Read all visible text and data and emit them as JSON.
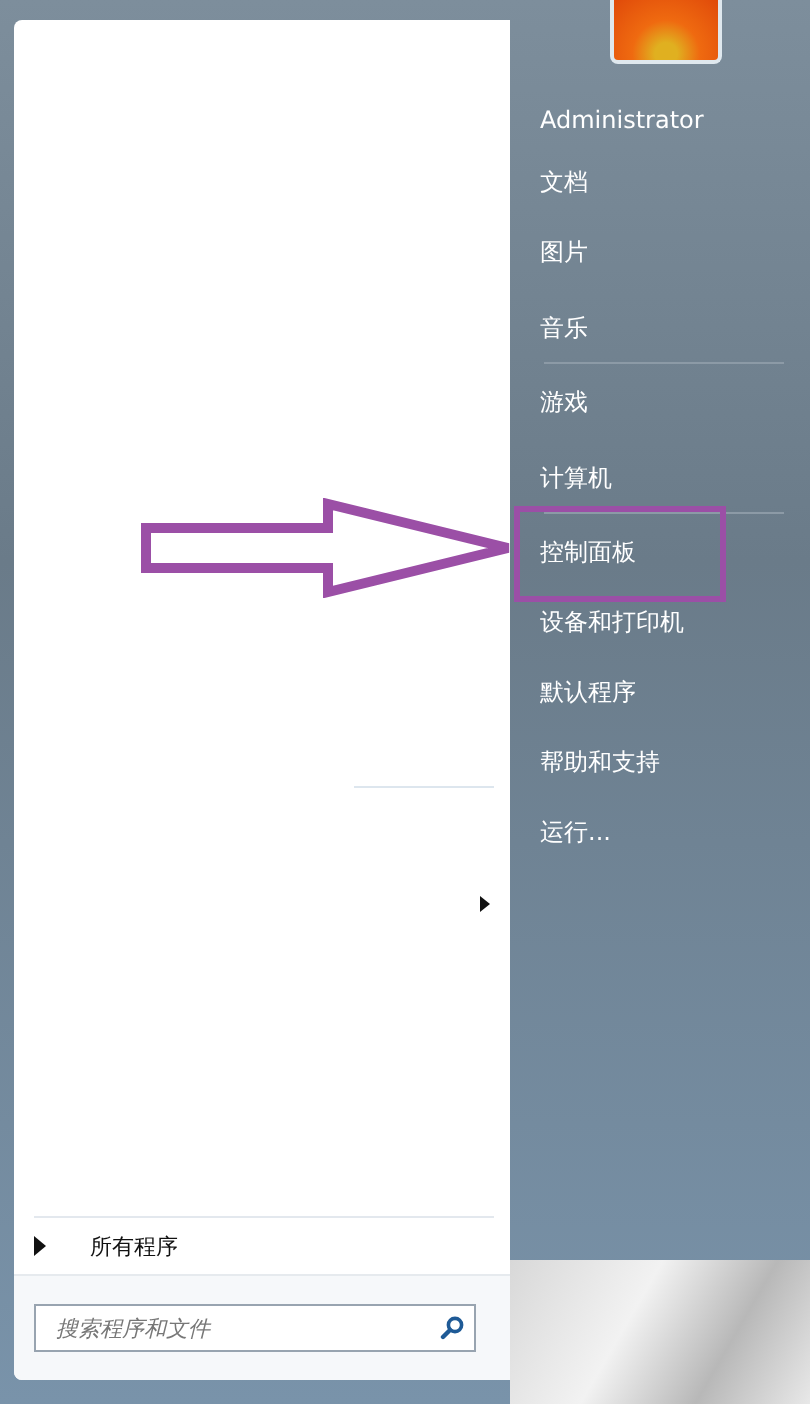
{
  "user": {
    "name": "Administrator"
  },
  "right_items": [
    {
      "label": "文档",
      "separator_after": false,
      "annotated": false
    },
    {
      "label": "图片",
      "separator_after": false,
      "annotated": false
    },
    {
      "label": "音乐",
      "separator_after": true,
      "annotated": false
    },
    {
      "label": "游戏",
      "separator_after": false,
      "annotated": false
    },
    {
      "label": "计算机",
      "separator_after": true,
      "annotated": false
    },
    {
      "label": "控制面板",
      "separator_after": false,
      "annotated": true
    },
    {
      "label": "设备和打印机",
      "separator_after": false,
      "annotated": false
    },
    {
      "label": "默认程序",
      "separator_after": false,
      "annotated": false
    },
    {
      "label": "帮助和支持",
      "separator_after": false,
      "annotated": false
    },
    {
      "label": "运行...",
      "separator_after": false,
      "annotated": false
    }
  ],
  "all_programs": {
    "label": "所有程序"
  },
  "search": {
    "placeholder": "搜索程序和文件"
  }
}
